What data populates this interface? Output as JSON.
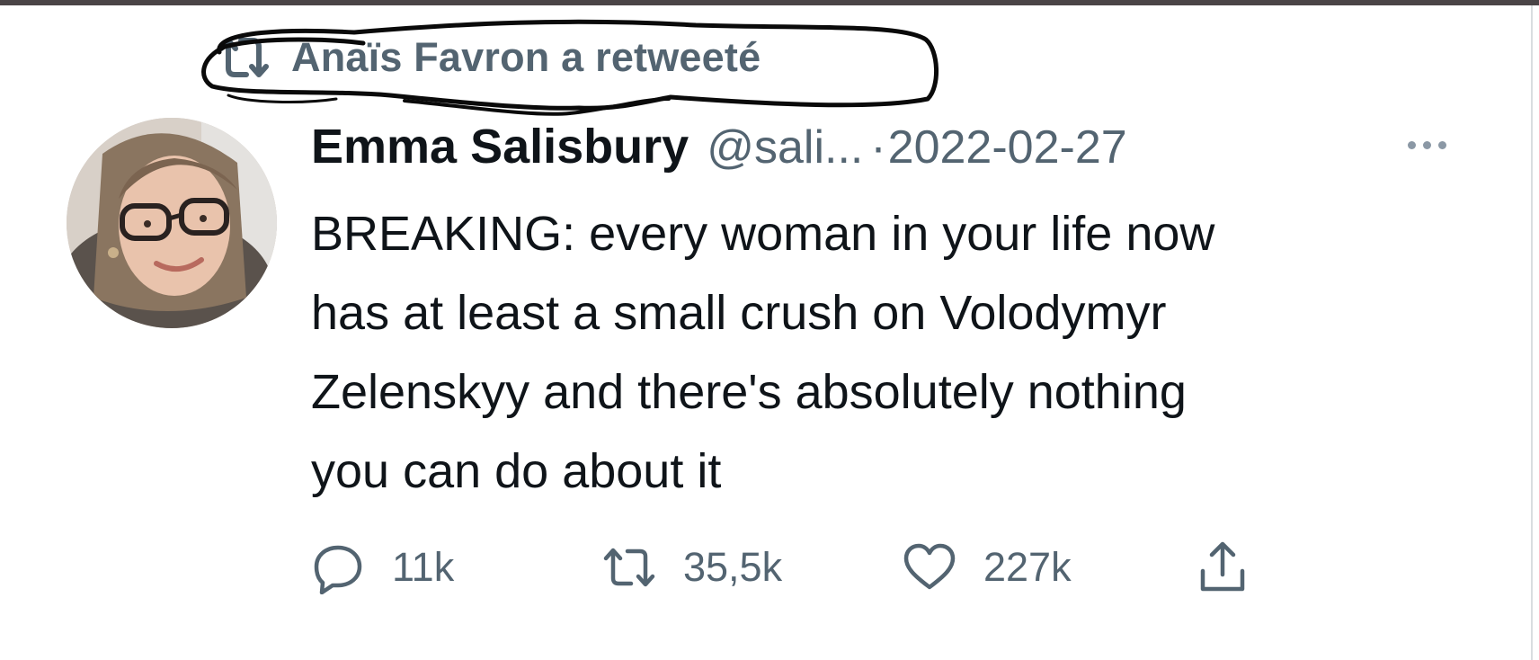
{
  "social_context": {
    "retweeted_by": "Anaïs Favron a retweeté"
  },
  "author": {
    "display_name": "Emma Salisbury",
    "handle": "@sali...",
    "separator": "·",
    "date": "2022-02-27"
  },
  "tweet": {
    "lines": [
      "BREAKING: every woman in your life now",
      "has at least a small crush on Volodymyr",
      "Zelenskyy and there's absolutely nothing",
      "you can do about it"
    ]
  },
  "actions": {
    "reply_count": "11k",
    "retweet_count": "35,5k",
    "like_count": "227k"
  },
  "icons": {
    "retweet": "retweet-icon",
    "reply": "reply-icon",
    "like": "heart-icon",
    "share": "share-icon",
    "more": "more-icon"
  },
  "colors": {
    "text_primary": "#0f1419",
    "text_secondary": "#536471",
    "scribble": "#0a0a0a"
  }
}
